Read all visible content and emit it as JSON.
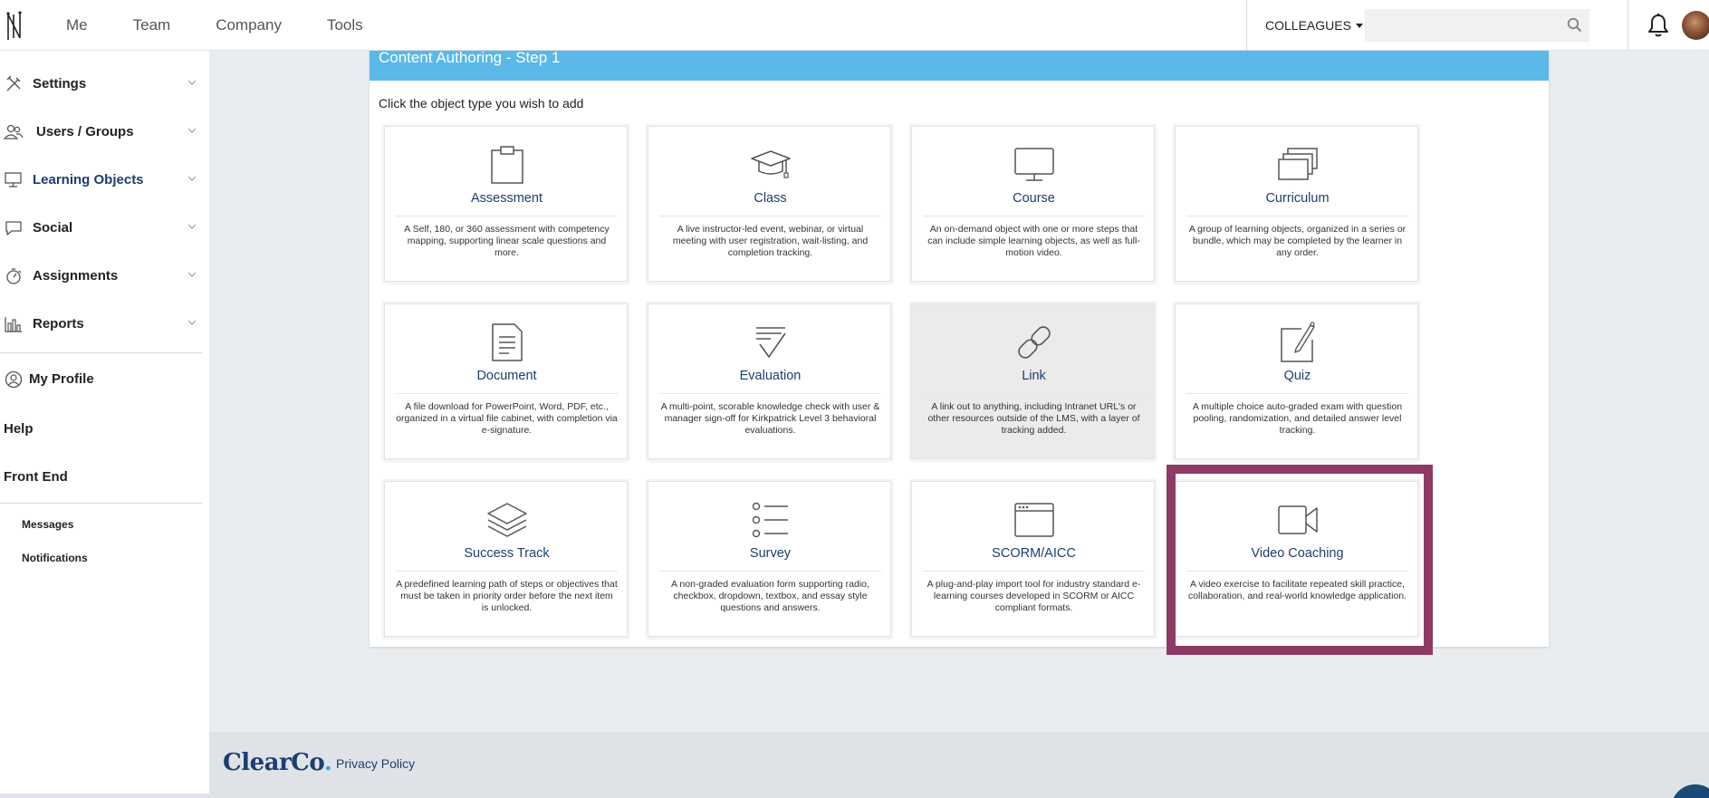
{
  "topnav": {
    "items": [
      "Me",
      "Team",
      "Company",
      "Tools"
    ]
  },
  "header": {
    "colleagues_label": "COLLEAGUES",
    "search_value": "",
    "search_placeholder": ""
  },
  "sidebar": {
    "items": [
      {
        "label": "Settings",
        "icon": "tools-icon"
      },
      {
        "label": "Users / Groups",
        "icon": "users-icon"
      },
      {
        "label": "Learning Objects",
        "icon": "monitor-icon"
      },
      {
        "label": "Social",
        "icon": "chat-icon"
      },
      {
        "label": "Assignments",
        "icon": "stopwatch-icon"
      },
      {
        "label": "Reports",
        "icon": "bar-chart-icon"
      }
    ],
    "my_profile": "My Profile",
    "help": "Help",
    "front_end": "Front End",
    "messages": "Messages",
    "notifications": "Notifications"
  },
  "panel": {
    "title": "Content Authoring - Step 1",
    "instructions": "Click the object type you wish to add"
  },
  "cards": [
    {
      "title": "Assessment",
      "icon": "clipboard-icon",
      "desc": "A Self, 180, or 360 assessment with competency mapping, supporting linear scale questions and more."
    },
    {
      "title": "Class",
      "icon": "graduation-cap-icon",
      "desc": "A live instructor-led event, webinar, or virtual meeting with user registration, wait-listing, and completion tracking."
    },
    {
      "title": "Course",
      "icon": "monitor-icon",
      "desc": "An on-demand object with one or more steps that can include simple learning objects, as well as full-motion video."
    },
    {
      "title": "Curriculum",
      "icon": "stacked-windows-icon",
      "desc": "A group of learning objects, organized in a series or bundle, which may be completed by the learner in any order."
    },
    {
      "title": "Document",
      "icon": "document-icon",
      "desc": "A file download for PowerPoint, Word, PDF, etc., organized in a virtual file cabinet, with completion via e-signature."
    },
    {
      "title": "Evaluation",
      "icon": "checklist-icon",
      "desc": "A multi-point, scorable knowledge check with user & manager sign-off for Kirkpatrick Level 3 behavioral evaluations."
    },
    {
      "title": "Link",
      "icon": "link-icon",
      "desc": "A link out to anything, including Intranet URL's or other resources outside of the LMS, with a layer of tracking added."
    },
    {
      "title": "Quiz",
      "icon": "pencil-paper-icon",
      "desc": "A multiple choice auto-graded exam with question pooling, randomization, and detailed answer level tracking."
    },
    {
      "title": "Success Track",
      "icon": "layers-icon",
      "desc": "A predefined learning path of steps or objectives that must be taken in priority order before the next item is unlocked."
    },
    {
      "title": "Survey",
      "icon": "list-icon",
      "desc": "A non-graded evaluation form supporting radio, checkbox, dropdown, textbox, and essay style questions and answers."
    },
    {
      "title": "SCORM/AICC",
      "icon": "browser-window-icon",
      "desc": "A plug-and-play import tool for industry standard e-learning courses developed in SCORM or AICC compliant formats."
    },
    {
      "title": "Video Coaching",
      "icon": "video-camera-icon",
      "desc": "A video exercise to facilitate repeated skill practice, collaboration, and real-world knowledge application."
    }
  ],
  "footer": {
    "brand": "ClearCo",
    "brand_dot": ".",
    "privacy": "Privacy Policy"
  },
  "colors": {
    "accent_blue": "#5bb8e8",
    "navy": "#1c3e6e",
    "highlight": "#8e3a64",
    "background": "#eaedf0"
  }
}
